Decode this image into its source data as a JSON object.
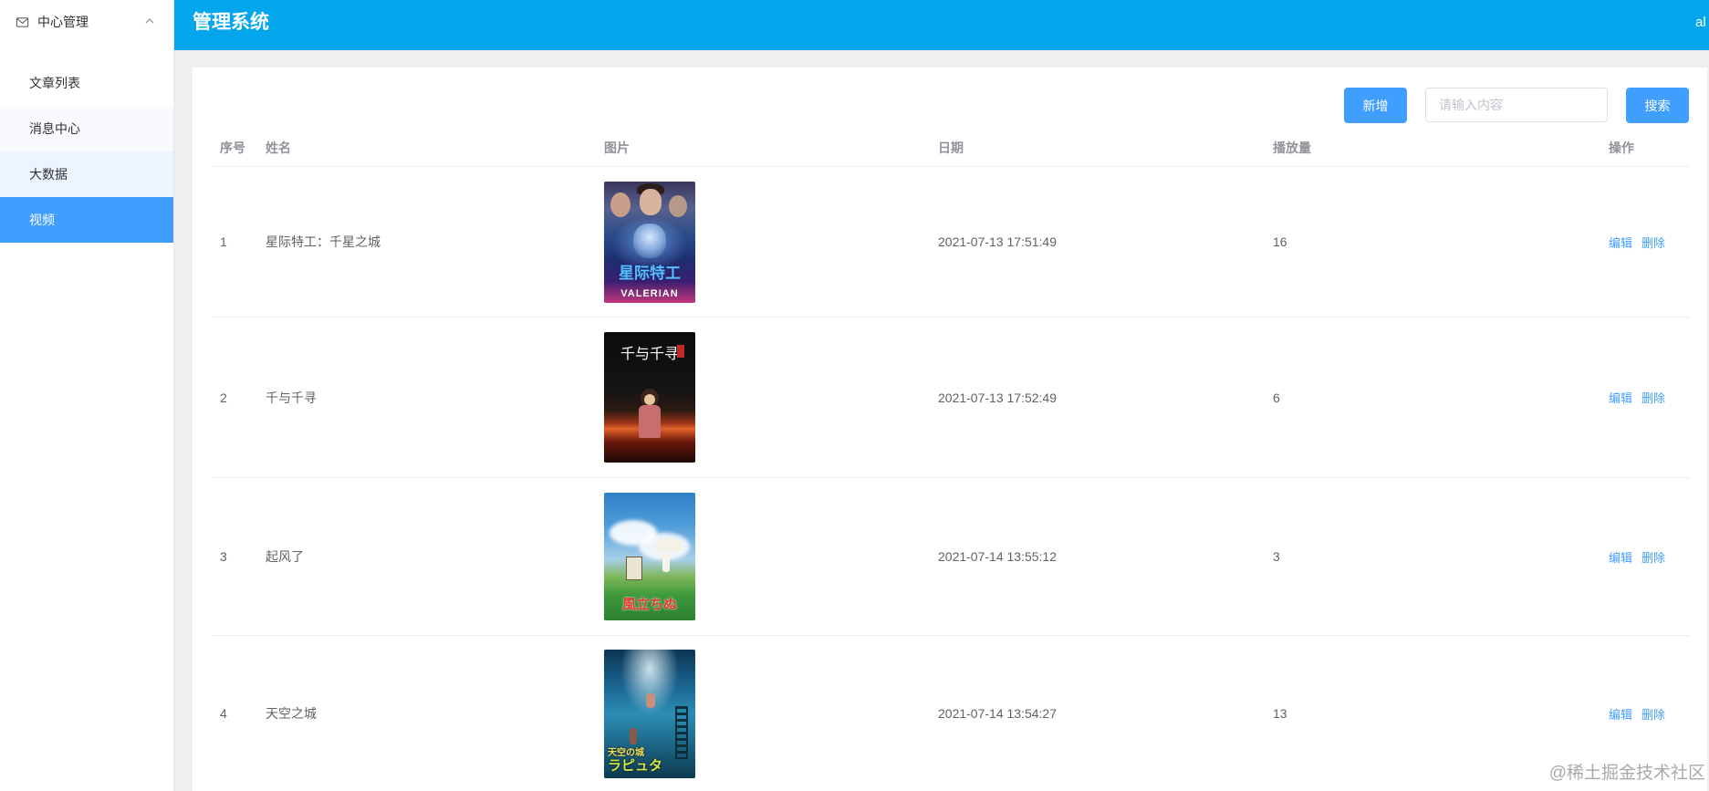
{
  "theme": {
    "primary": "#409eff",
    "header_bg": "#03a6ec"
  },
  "app": {
    "title": "管理系统",
    "user": "al"
  },
  "sidebar": {
    "group": {
      "label": "中心管理",
      "icon": "mail-icon",
      "toggle_icon": "chevron-up-icon",
      "expanded": true
    },
    "items": [
      {
        "label": "文章列表",
        "active": false
      },
      {
        "label": "消息中心",
        "active": false
      },
      {
        "label": "大数据",
        "active": false
      },
      {
        "label": "视频",
        "active": true
      }
    ]
  },
  "toolbar": {
    "add_label": "新增",
    "search_placeholder": "请输入内容",
    "search_value": "",
    "search_label": "搜索"
  },
  "table": {
    "columns": [
      "序号",
      "姓名",
      "图片",
      "日期",
      "播放量",
      "操作"
    ],
    "actions": {
      "edit": "编辑",
      "delete": "删除"
    },
    "rows": [
      {
        "index": "1",
        "name": "星际特工：千星之城",
        "date": "2021-07-13 17:51:49",
        "plays": "16",
        "poster": {
          "title_cn": "星际特工",
          "title_en": "VALERIAN"
        }
      },
      {
        "index": "2",
        "name": "千与千寻",
        "date": "2021-07-13 17:52:49",
        "plays": "6",
        "poster": {
          "title": "千与千寻"
        }
      },
      {
        "index": "3",
        "name": "起风了",
        "date": "2021-07-14 13:55:12",
        "plays": "3",
        "poster": {
          "title": "風立ちぬ"
        }
      },
      {
        "index": "4",
        "name": "天空之城",
        "date": "2021-07-14 13:54:27",
        "plays": "13",
        "poster": {
          "title_top": "天空の城",
          "title": "ラピュタ"
        }
      }
    ]
  },
  "watermark": "@稀土掘金技术社区"
}
